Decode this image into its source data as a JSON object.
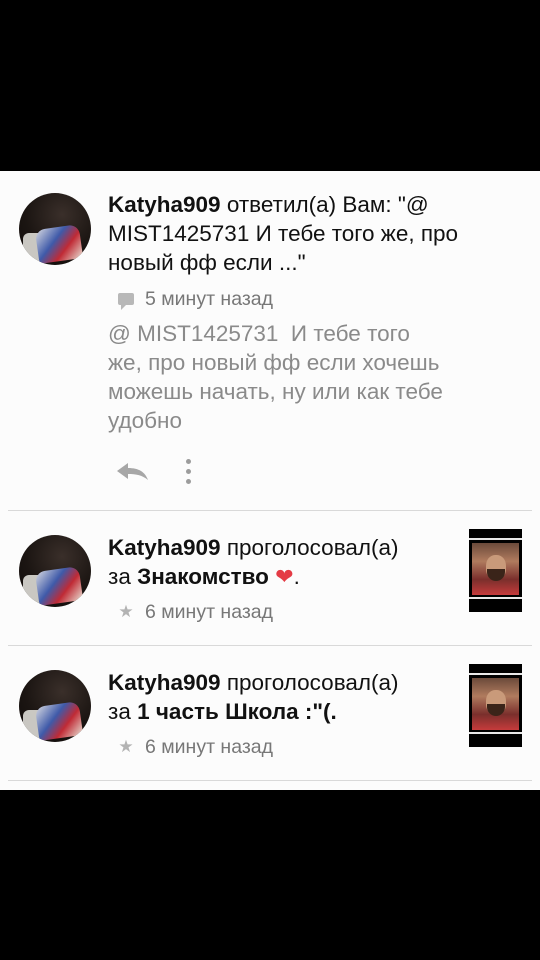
{
  "feed": [
    {
      "type": "reply",
      "user": "Katyha909",
      "verb": "ответил(а) Вам:",
      "quote_line": "\"@ MIST1425731 И тебе того же, про новый фф если ...\"",
      "meta_icon": "comment-icon",
      "time": "5 минут назад",
      "body": "@ MIST1425731  И тебе того\nже, про новый фф если хочешь\nможешь начать, ну или как тебе\nудобно",
      "actions": {
        "reply_icon": "reply-icon",
        "more_icon": "more-vertical-icon"
      }
    },
    {
      "type": "vote",
      "user": "Katyha909",
      "verb": "проголосовал(а)",
      "prep": "за",
      "target": "Знакомство",
      "suffix": ".",
      "meta_icon": "star-icon",
      "time": "6 минут назад"
    },
    {
      "type": "vote",
      "user": "Katyha909",
      "verb": "проголосовал(а)",
      "prep": "за",
      "target": "1 часть Школа :\"(.",
      "suffix": "",
      "meta_icon": "star-icon",
      "time": "6 минут назад"
    }
  ],
  "colors": {
    "background": "#fcfcfc",
    "letterbox": "#000000",
    "primary_text": "#111111",
    "secondary_text": "#8a8a8a",
    "heart": "#e43b45"
  }
}
